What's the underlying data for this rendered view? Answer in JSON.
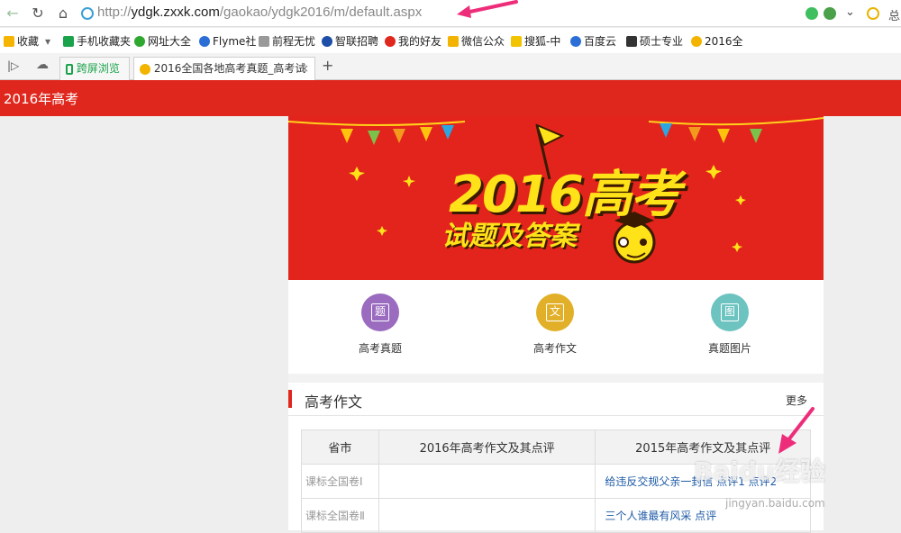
{
  "browser": {
    "url_prefix": "http://",
    "url_domain": "ydgk.zxxk.com",
    "url_path": "/gaokao/ydgk2016/m/default.aspx",
    "right_text": "总"
  },
  "bookmarks": [
    {
      "label": "收藏",
      "color": "#f5b400"
    },
    {
      "label": "手机收藏夹",
      "color": "#1aa34a"
    },
    {
      "label": "网址大全",
      "color": "#2fa82f"
    },
    {
      "label": "Flyme社",
      "color": "#2b6fd6"
    },
    {
      "label": "前程无忧",
      "color": "#777777"
    },
    {
      "label": "智联招聘",
      "color": "#1e4fa8"
    },
    {
      "label": "我的好友",
      "color": "#e0271d"
    },
    {
      "label": "微信公众",
      "color": "#f2b400"
    },
    {
      "label": "搜狐-中",
      "color": "#f2c400"
    },
    {
      "label": "百度云",
      "color": "#2b6fd6"
    },
    {
      "label": "硕士专业",
      "color": "#333333"
    },
    {
      "label": "2016全",
      "color": "#f2b400"
    }
  ],
  "tabs": {
    "tab1": "跨屏浏览",
    "tab2": "2016全国各地高考真题_高考试",
    "close": "×",
    "new": "+"
  },
  "site": {
    "header_title": "2016年高考",
    "banner_line1": "2016高考",
    "banner_line2": "试题及答案",
    "categories": [
      {
        "label": "高考真题",
        "glyph": "题",
        "color": "#9a6bbf"
      },
      {
        "label": "高考作文",
        "glyph": "文",
        "color": "#e2b028"
      },
      {
        "label": "真题图片",
        "glyph": "图",
        "color": "#6cc3c0"
      }
    ],
    "panel_title": "高考作文",
    "panel_more": "更多",
    "table": {
      "headers": [
        "省市",
        "2016年高考作文及其点评",
        "2015年高考作文及其点评"
      ],
      "rows": [
        {
          "prov": "课标全国卷Ⅰ",
          "c2016": "",
          "c2015": "给违反交规父亲一封信  点评1  点评2"
        },
        {
          "prov": "课标全国卷Ⅱ",
          "c2016": "",
          "c2015": "三个人谁最有风采  点评"
        }
      ]
    },
    "watermark": "Baidu经验",
    "watermark_url": "jingyan.baidu.com"
  },
  "colors": {
    "header_red": "#e0271d",
    "link": "#1d5aa6"
  }
}
